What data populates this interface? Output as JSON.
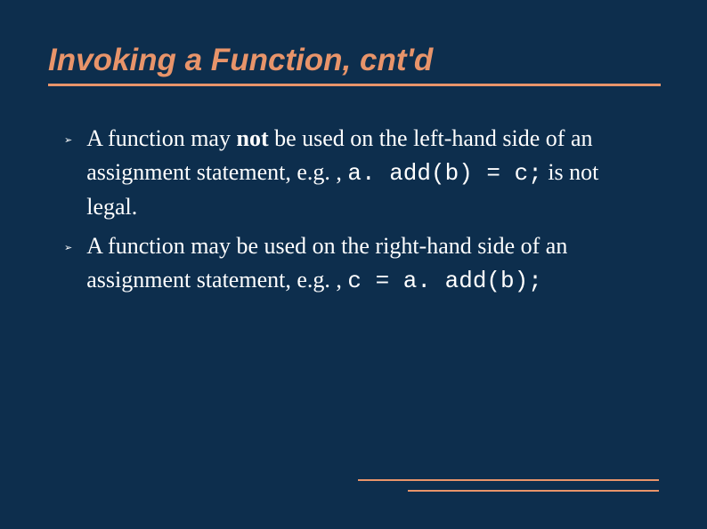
{
  "title": "Invoking a Function, cnt'd",
  "bullets": [
    {
      "pre": " A function may ",
      "bold": "not",
      "mid": " be used on the left-hand side of an assignment statement, e.g. ,  ",
      "code": "a. add(b)  = c;",
      "post": "  is not legal."
    },
    {
      "pre": " A function may be used on the right-hand side of an assignment statement, e.g. , ",
      "bold": "",
      "mid": "",
      "code": "c  =  a. add(b);",
      "post": ""
    }
  ]
}
